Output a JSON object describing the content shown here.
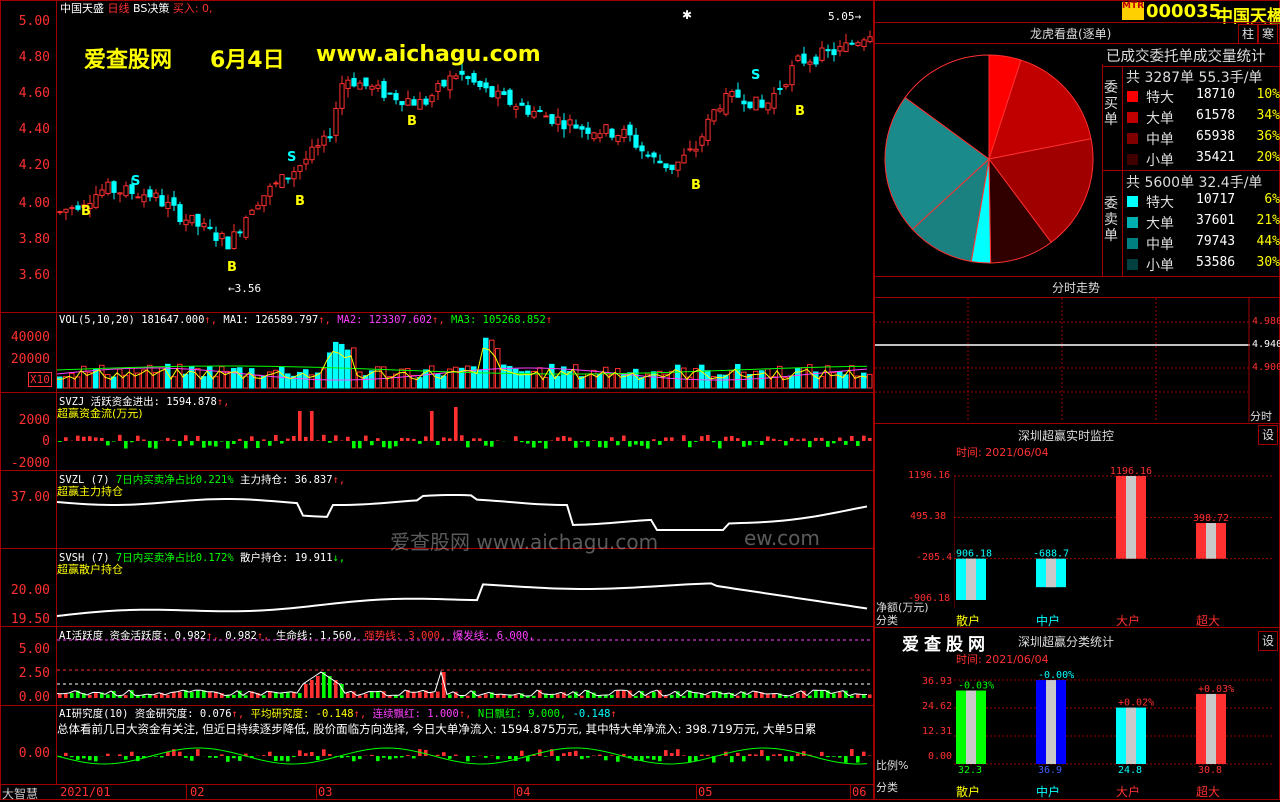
{
  "main_chart": {
    "stock_name": "中国天盛",
    "period": "日线",
    "indicator": "BS决策",
    "signal": "买入: 0,",
    "y_ticks": [
      "5.00",
      "4.80",
      "4.60",
      "4.40",
      "4.20",
      "4.00",
      "3.80",
      "3.60"
    ],
    "low_marker": "3.56",
    "high_marker": "5.05",
    "watermark_site": "爱查股网",
    "watermark_date": "6月4日",
    "watermark_url": "www.aichagu.com",
    "signal_b": "B",
    "signal_s": "S"
  },
  "vol_panel": {
    "label": "VOL(5,10,20)",
    "value": "181647.000",
    "ma1": "MA1: 126589.797",
    "ma2": "MA2: 123307.602",
    "ma3": "MA3: 105268.852",
    "ticks": [
      "40000",
      "20000"
    ],
    "unit": "X10"
  },
  "svzj_panel": {
    "label": "SVZJ  活跃资金进出: 1594.878",
    "sub": "超赢资金流(万元)",
    "ticks": [
      "2000",
      "0",
      "-2000"
    ]
  },
  "svzl_panel": {
    "label": "SVZL (7)",
    "ratio": "7日内买卖净占比0.221%",
    "hold": "主力持仓: 36.837",
    "sub": "超赢主力持仓",
    "ticks": [
      "37.00"
    ]
  },
  "svsh_panel": {
    "label": "SVSH (7)",
    "ratio": "7日内买卖净占比0.172%",
    "hold": "散户持仓: 19.911",
    "sub": "超赢散户持仓",
    "ticks": [
      "20.00",
      "19.50"
    ],
    "watermark": "爱查股网  www.aichagu.com",
    "watermark2": "ew.com"
  },
  "ai_panel": {
    "label": "AI活跃度",
    "activity": "资金活跃度: 0.982",
    "v2": "0.982",
    "life": "生命线: 1.560,",
    "strong": "强势线: 3.000,",
    "burst": "爆发线: 6.000,",
    "ticks": [
      "5.00",
      "2.50",
      "0.00"
    ]
  },
  "research_panel": {
    "label": "AI研究度(10)",
    "research": "资金研究度: 0.076",
    "avg": "平均研究度: -0.148",
    "streak": "连续飘红: 1.000",
    "nday": "N日飘红: 9.000,",
    "tail": "-0.148",
    "summary": "总体看前几日大资金有关注, 但近日持续逐步降低, 股价面临方向选择, 今日大单净流入: 1594.875万元, 其中特大单净流入: 398.719万元, 大单5日累",
    "ticks": [
      "0.00"
    ]
  },
  "xaxis": {
    "left_label": "大智慧",
    "dates": [
      "2021/01",
      "02",
      "03",
      "04",
      "05",
      "06"
    ]
  },
  "top_right": {
    "code": "000035",
    "name": "中国天楹",
    "tag": "MTR",
    "btn_zhu": "柱",
    "btn_han": "寒"
  },
  "pie_panel": {
    "title": "龙虎看盘(逐单)",
    "subtitle": "已成交委托单成交量统计",
    "buy_label": "委买单",
    "sell_label": "委卖单",
    "buy_total": "共 3287单 55.3手/单",
    "sell_total": "共 5600单 32.4手/单",
    "buy_rows": [
      {
        "type": "特大",
        "vol": "18710",
        "pct": "10%",
        "color": "#ff0000"
      },
      {
        "type": "大单",
        "vol": "61578",
        "pct": "34%",
        "color": "#c00000"
      },
      {
        "type": "中单",
        "vol": "65938",
        "pct": "36%",
        "color": "#800000"
      },
      {
        "type": "小单",
        "vol": "35421",
        "pct": "20%",
        "color": "#400000"
      }
    ],
    "sell_rows": [
      {
        "type": "特大",
        "vol": "10717",
        "pct": "6%",
        "color": "#00ffff"
      },
      {
        "type": "大单",
        "vol": "37601",
        "pct": "21%",
        "color": "#00b0b0"
      },
      {
        "type": "中单",
        "vol": "79743",
        "pct": "44%",
        "color": "#008080"
      },
      {
        "type": "小单",
        "vol": "53586",
        "pct": "30%",
        "color": "#004040"
      }
    ]
  },
  "intraday_panel": {
    "title": "分时走势",
    "ticks": [
      "4.980",
      "4.940",
      "4.900"
    ],
    "footer": "分时"
  },
  "monitor_panel": {
    "title": "深圳超赢实时监控",
    "btn": "设",
    "time": "时间: 2021/06/04",
    "ticks": [
      "1196.16",
      "495.38",
      "-205.4",
      "-906.18"
    ],
    "axis_label": "净额(万元)",
    "cat_label": "分类",
    "categories": [
      "散户",
      "中户",
      "大户",
      "超大"
    ],
    "values": [
      "-906.18",
      "-688.7",
      "1196.16",
      "398.72"
    ]
  },
  "classify_panel": {
    "logo": "爱查股网",
    "title": "深圳超赢分类统计",
    "btn": "设",
    "time": "时间: 2021/06/04",
    "ticks": [
      "36.93",
      "24.62",
      "12.31",
      "0.00"
    ],
    "ratio_label": "比例%",
    "cat_label": "分类",
    "categories": [
      "散户",
      "中户",
      "大户",
      "超大"
    ],
    "top_labels": [
      "-0.03%",
      "-0.00%",
      "+0.02%",
      "+0.03%"
    ],
    "bottom_labels": [
      "32.3",
      "36.9",
      "24.8",
      "30.8"
    ]
  },
  "chart_data": [
    {
      "type": "bar",
      "title": "深圳超赢实时监控",
      "categories": [
        "散户",
        "中户",
        "大户",
        "超大"
      ],
      "values": [
        -906.18,
        -688.7,
        1196.16,
        398.72
      ],
      "ylabel": "净额(万元)",
      "ylim": [
        -906.18,
        1196.16
      ]
    },
    {
      "type": "bar",
      "title": "深圳超赢分类统计",
      "categories": [
        "散户",
        "中户",
        "大户",
        "超大"
      ],
      "values": [
        32.3,
        36.9,
        24.8,
        30.8
      ],
      "ylabel": "比例%",
      "ylim": [
        0,
        36.93
      ]
    },
    {
      "type": "pie",
      "title": "龙虎看盘(逐单)",
      "categories": [
        "买特大",
        "买大单",
        "买中单",
        "买小单",
        "卖特大",
        "卖大单",
        "卖中单",
        "卖小单"
      ],
      "values": [
        5,
        17,
        18,
        10,
        3,
        10.5,
        22,
        15
      ]
    }
  ]
}
